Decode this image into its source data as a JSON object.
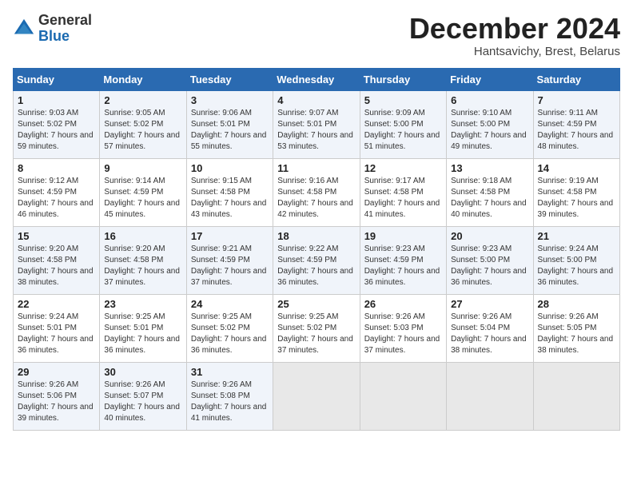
{
  "header": {
    "logo": {
      "general": "General",
      "blue": "Blue"
    },
    "title": "December 2024",
    "location": "Hantsavichy, Brest, Belarus"
  },
  "calendar": {
    "days_of_week": [
      "Sunday",
      "Monday",
      "Tuesday",
      "Wednesday",
      "Thursday",
      "Friday",
      "Saturday"
    ],
    "weeks": [
      [
        {
          "day": "1",
          "sunrise": "Sunrise: 9:03 AM",
          "sunset": "Sunset: 5:02 PM",
          "daylight": "Daylight: 7 hours and 59 minutes."
        },
        {
          "day": "2",
          "sunrise": "Sunrise: 9:05 AM",
          "sunset": "Sunset: 5:02 PM",
          "daylight": "Daylight: 7 hours and 57 minutes."
        },
        {
          "day": "3",
          "sunrise": "Sunrise: 9:06 AM",
          "sunset": "Sunset: 5:01 PM",
          "daylight": "Daylight: 7 hours and 55 minutes."
        },
        {
          "day": "4",
          "sunrise": "Sunrise: 9:07 AM",
          "sunset": "Sunset: 5:01 PM",
          "daylight": "Daylight: 7 hours and 53 minutes."
        },
        {
          "day": "5",
          "sunrise": "Sunrise: 9:09 AM",
          "sunset": "Sunset: 5:00 PM",
          "daylight": "Daylight: 7 hours and 51 minutes."
        },
        {
          "day": "6",
          "sunrise": "Sunrise: 9:10 AM",
          "sunset": "Sunset: 5:00 PM",
          "daylight": "Daylight: 7 hours and 49 minutes."
        },
        {
          "day": "7",
          "sunrise": "Sunrise: 9:11 AM",
          "sunset": "Sunset: 4:59 PM",
          "daylight": "Daylight: 7 hours and 48 minutes."
        }
      ],
      [
        {
          "day": "8",
          "sunrise": "Sunrise: 9:12 AM",
          "sunset": "Sunset: 4:59 PM",
          "daylight": "Daylight: 7 hours and 46 minutes."
        },
        {
          "day": "9",
          "sunrise": "Sunrise: 9:14 AM",
          "sunset": "Sunset: 4:59 PM",
          "daylight": "Daylight: 7 hours and 45 minutes."
        },
        {
          "day": "10",
          "sunrise": "Sunrise: 9:15 AM",
          "sunset": "Sunset: 4:58 PM",
          "daylight": "Daylight: 7 hours and 43 minutes."
        },
        {
          "day": "11",
          "sunrise": "Sunrise: 9:16 AM",
          "sunset": "Sunset: 4:58 PM",
          "daylight": "Daylight: 7 hours and 42 minutes."
        },
        {
          "day": "12",
          "sunrise": "Sunrise: 9:17 AM",
          "sunset": "Sunset: 4:58 PM",
          "daylight": "Daylight: 7 hours and 41 minutes."
        },
        {
          "day": "13",
          "sunrise": "Sunrise: 9:18 AM",
          "sunset": "Sunset: 4:58 PM",
          "daylight": "Daylight: 7 hours and 40 minutes."
        },
        {
          "day": "14",
          "sunrise": "Sunrise: 9:19 AM",
          "sunset": "Sunset: 4:58 PM",
          "daylight": "Daylight: 7 hours and 39 minutes."
        }
      ],
      [
        {
          "day": "15",
          "sunrise": "Sunrise: 9:20 AM",
          "sunset": "Sunset: 4:58 PM",
          "daylight": "Daylight: 7 hours and 38 minutes."
        },
        {
          "day": "16",
          "sunrise": "Sunrise: 9:20 AM",
          "sunset": "Sunset: 4:58 PM",
          "daylight": "Daylight: 7 hours and 37 minutes."
        },
        {
          "day": "17",
          "sunrise": "Sunrise: 9:21 AM",
          "sunset": "Sunset: 4:59 PM",
          "daylight": "Daylight: 7 hours and 37 minutes."
        },
        {
          "day": "18",
          "sunrise": "Sunrise: 9:22 AM",
          "sunset": "Sunset: 4:59 PM",
          "daylight": "Daylight: 7 hours and 36 minutes."
        },
        {
          "day": "19",
          "sunrise": "Sunrise: 9:23 AM",
          "sunset": "Sunset: 4:59 PM",
          "daylight": "Daylight: 7 hours and 36 minutes."
        },
        {
          "day": "20",
          "sunrise": "Sunrise: 9:23 AM",
          "sunset": "Sunset: 5:00 PM",
          "daylight": "Daylight: 7 hours and 36 minutes."
        },
        {
          "day": "21",
          "sunrise": "Sunrise: 9:24 AM",
          "sunset": "Sunset: 5:00 PM",
          "daylight": "Daylight: 7 hours and 36 minutes."
        }
      ],
      [
        {
          "day": "22",
          "sunrise": "Sunrise: 9:24 AM",
          "sunset": "Sunset: 5:01 PM",
          "daylight": "Daylight: 7 hours and 36 minutes."
        },
        {
          "day": "23",
          "sunrise": "Sunrise: 9:25 AM",
          "sunset": "Sunset: 5:01 PM",
          "daylight": "Daylight: 7 hours and 36 minutes."
        },
        {
          "day": "24",
          "sunrise": "Sunrise: 9:25 AM",
          "sunset": "Sunset: 5:02 PM",
          "daylight": "Daylight: 7 hours and 36 minutes."
        },
        {
          "day": "25",
          "sunrise": "Sunrise: 9:25 AM",
          "sunset": "Sunset: 5:02 PM",
          "daylight": "Daylight: 7 hours and 37 minutes."
        },
        {
          "day": "26",
          "sunrise": "Sunrise: 9:26 AM",
          "sunset": "Sunset: 5:03 PM",
          "daylight": "Daylight: 7 hours and 37 minutes."
        },
        {
          "day": "27",
          "sunrise": "Sunrise: 9:26 AM",
          "sunset": "Sunset: 5:04 PM",
          "daylight": "Daylight: 7 hours and 38 minutes."
        },
        {
          "day": "28",
          "sunrise": "Sunrise: 9:26 AM",
          "sunset": "Sunset: 5:05 PM",
          "daylight": "Daylight: 7 hours and 38 minutes."
        }
      ],
      [
        {
          "day": "29",
          "sunrise": "Sunrise: 9:26 AM",
          "sunset": "Sunset: 5:06 PM",
          "daylight": "Daylight: 7 hours and 39 minutes."
        },
        {
          "day": "30",
          "sunrise": "Sunrise: 9:26 AM",
          "sunset": "Sunset: 5:07 PM",
          "daylight": "Daylight: 7 hours and 40 minutes."
        },
        {
          "day": "31",
          "sunrise": "Sunrise: 9:26 AM",
          "sunset": "Sunset: 5:08 PM",
          "daylight": "Daylight: 7 hours and 41 minutes."
        },
        null,
        null,
        null,
        null
      ]
    ]
  }
}
